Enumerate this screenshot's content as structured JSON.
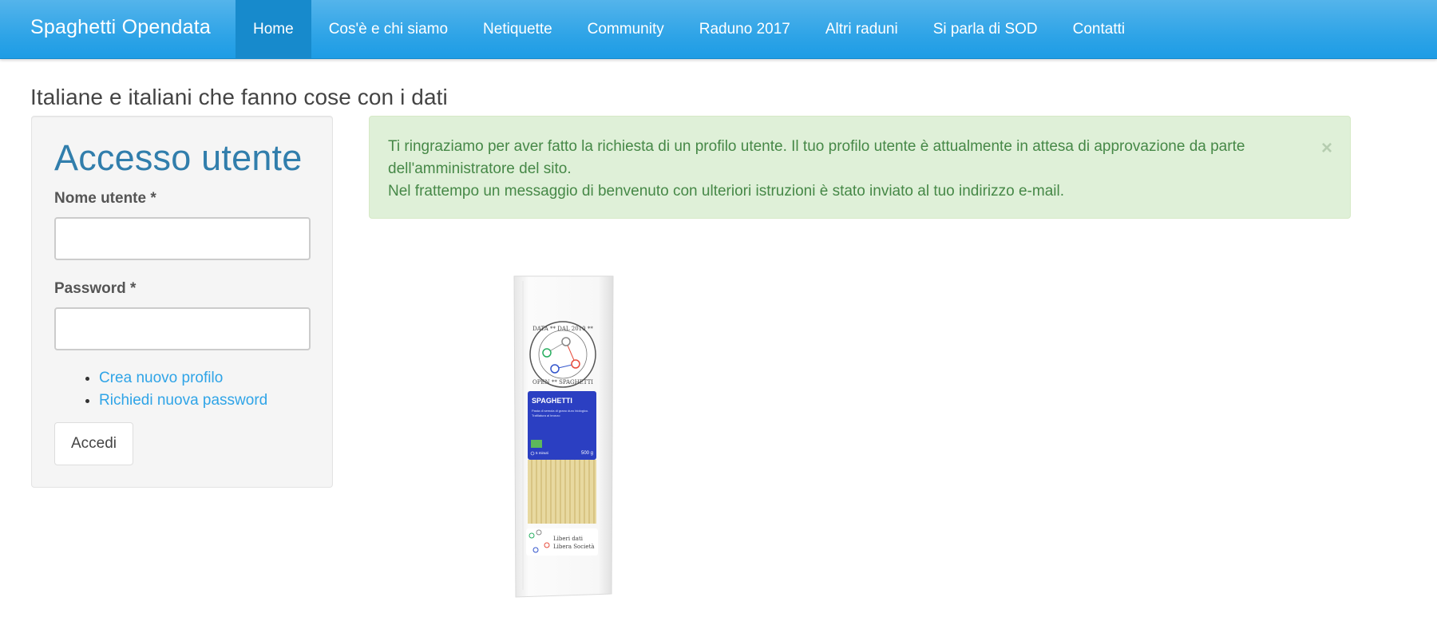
{
  "navbar": {
    "brand": "Spaghetti Opendata",
    "items": [
      {
        "label": "Home",
        "active": true
      },
      {
        "label": "Cos'è e chi siamo"
      },
      {
        "label": "Netiquette"
      },
      {
        "label": "Community"
      },
      {
        "label": "Raduno 2017"
      },
      {
        "label": "Altri raduni"
      },
      {
        "label": "Si parla di SOD"
      },
      {
        "label": "Contatti"
      }
    ]
  },
  "tagline": "Italiane e italiani che fanno cose con i dati",
  "login": {
    "title": "Accesso utente",
    "username_label": "Nome utente *",
    "username_value": "",
    "password_label": "Password *",
    "password_value": "",
    "links": [
      "Crea nuovo profilo",
      "Richiedi nuova password"
    ],
    "submit": "Accedi"
  },
  "alert": {
    "line1": "Ti ringraziamo per aver fatto la richiesta di un profilo utente. Il tuo profilo utente è attualmente in attesa di approvazione da parte dell'amministratore del sito.",
    "line2": "Nel frattempo un messaggio di benvenuto con ulteriori istruzioni è stato inviato al tuo indirizzo e-mail.",
    "close": "×"
  },
  "colors": {
    "navbar": "#2fa4e7",
    "navbar_active": "#178acc",
    "link": "#2fa4e7",
    "heading": "#317eac",
    "alert_bg": "#dff0d8",
    "alert_text": "#468847"
  },
  "package": {
    "product": "SPAGHETTI",
    "description_1": "Pasta di semola di grano duro biologico.",
    "description_2": "Trafilatura al bronzo",
    "cooking": "5 minuti",
    "weight": "500 g",
    "seal_top": "DATA ** DAL 2010 **",
    "seal_bottom": "OPEN ** SPAGHETTI",
    "slogan_1": "Liberi dati",
    "slogan_2": "Libera Società"
  }
}
